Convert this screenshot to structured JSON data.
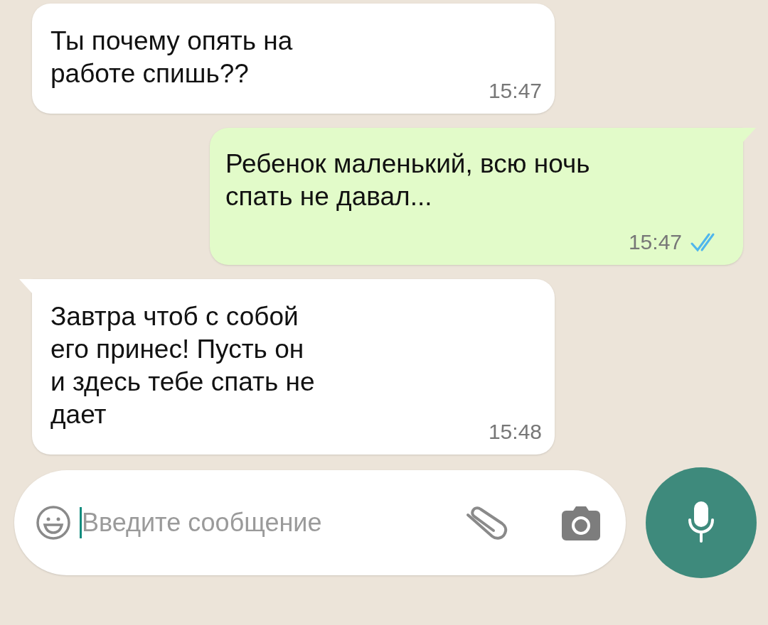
{
  "messages": [
    {
      "kind": "incoming",
      "tail": false,
      "text": "Ты почему опять на\nработе спишь??",
      "time": "15:47"
    },
    {
      "kind": "outgoing",
      "tail": true,
      "text": "Ребенок маленький, всю ночь\nспать не давал...",
      "time": "15:47",
      "read": true
    },
    {
      "kind": "incoming",
      "tail": true,
      "text": "Завтра чтоб с собой\nего принес! Пусть он\nи здесь тебе спать не\nдает",
      "time": "15:48"
    }
  ],
  "composer": {
    "placeholder": "Введите сообщение"
  }
}
